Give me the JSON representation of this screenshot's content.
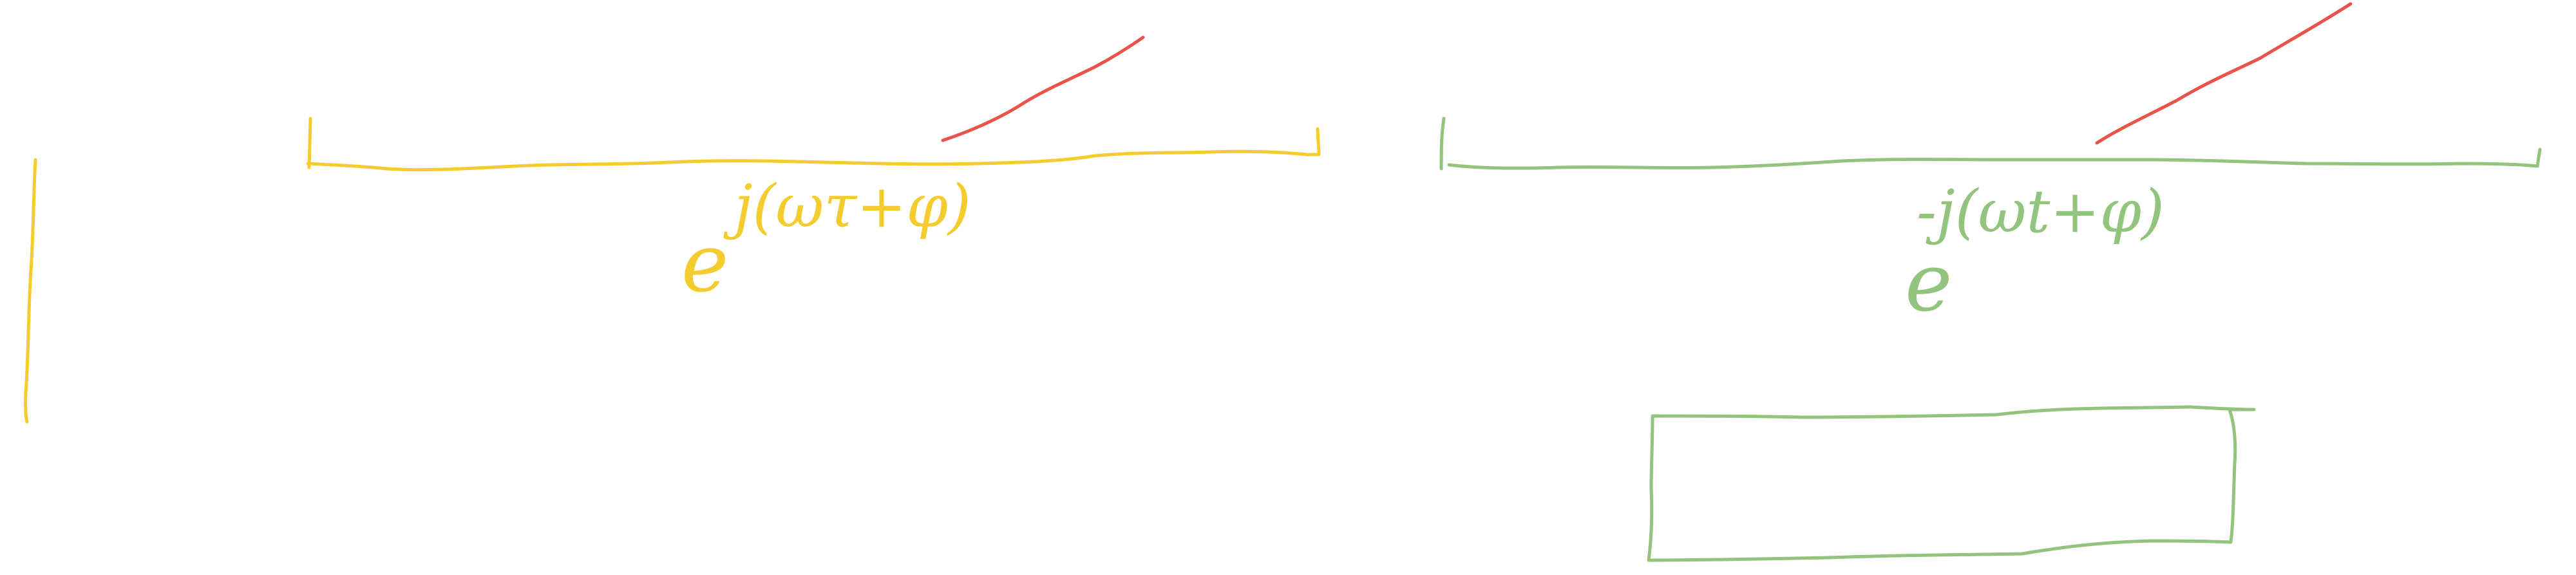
{
  "canvas": {
    "background": "#ffffff"
  },
  "colors": {
    "yellow": "#F5CC2F",
    "green": "#93C47D",
    "red": "#E8534A"
  },
  "annotations": {
    "left_expression": {
      "base": "e",
      "exponent": "j(ωτ+φ)"
    },
    "right_expression": {
      "base": "e",
      "exponent": "-j(ωt+φ)"
    }
  }
}
